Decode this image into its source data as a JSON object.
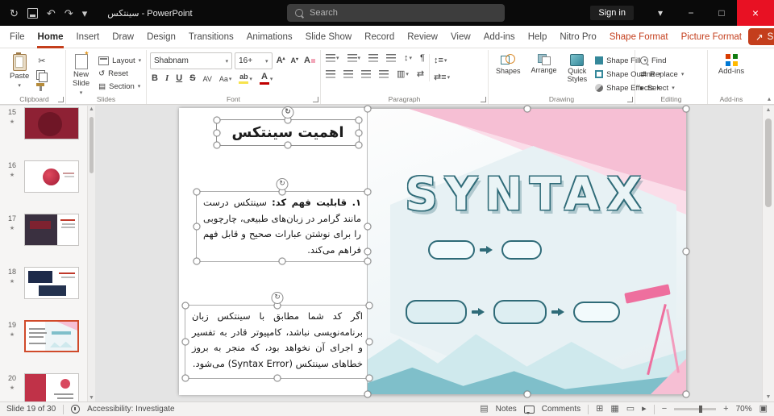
{
  "titlebar": {
    "title": "سینتکس - PowerPoint",
    "search_placeholder": "Search",
    "sign_in": "Sign in"
  },
  "menubar": {
    "tabs": [
      {
        "label": "File"
      },
      {
        "label": "Home"
      },
      {
        "label": "Insert"
      },
      {
        "label": "Draw"
      },
      {
        "label": "Design"
      },
      {
        "label": "Transitions"
      },
      {
        "label": "Animations"
      },
      {
        "label": "Slide Show"
      },
      {
        "label": "Record"
      },
      {
        "label": "Review"
      },
      {
        "label": "View"
      },
      {
        "label": "Add-ins"
      },
      {
        "label": "Help"
      },
      {
        "label": "Nitro Pro"
      },
      {
        "label": "Shape Format"
      },
      {
        "label": "Picture Format"
      }
    ],
    "active_tab": "Home",
    "share": "Share"
  },
  "ribbon": {
    "clipboard": {
      "paste": "Paste",
      "group": "Clipboard"
    },
    "slides": {
      "new_slide": "New Slide",
      "layout": "Layout",
      "reset": "Reset",
      "section": "Section",
      "group": "Slides"
    },
    "font": {
      "name": "Shabnam",
      "size": "16+",
      "group": "Font"
    },
    "paragraph": {
      "group": "Paragraph"
    },
    "drawing": {
      "shapes": "Shapes",
      "arrange": "Arrange",
      "quick_styles": "Quick Styles",
      "shape_fill": "Shape Fill",
      "shape_outline": "Shape Outline",
      "shape_effects": "Shape Effects",
      "group": "Drawing"
    },
    "editing": {
      "find": "Find",
      "replace": "Replace",
      "select": "Select",
      "group": "Editing"
    },
    "addins": {
      "button": "Add-ins",
      "group": "Add-ins"
    }
  },
  "panel": {
    "thumbs": [
      {
        "number": "15"
      },
      {
        "number": "16"
      },
      {
        "number": "17"
      },
      {
        "number": "18"
      },
      {
        "number": "19"
      },
      {
        "number": "20"
      }
    ],
    "selected": "19"
  },
  "slide": {
    "title": "اهمیت سینتکس",
    "body1_lead": "۱. قابلیت فهم کد:",
    "body1_rest": " سینتکس درست مانند گرامر در زبان‌های طبیعی، چارچوبی را برای نوشتن عبارات صحیح و قابل فهم فراهم می‌کند.",
    "body2": "اگر کد شما مطابق با سینتکس زبان برنامه‌نویسی نباشد، کامپیوتر قادر به تفسیر و اجرای آن نخواهد بود، که منجر به بروز خطاهای سینتکس (Syntax Error) می‌شود.",
    "graphic_word": "SYNTAX"
  },
  "statusbar": {
    "slide_info": "Slide 19 of 30",
    "accessibility": "Accessibility: Investigate",
    "notes": "Notes",
    "comments": "Comments",
    "zoom": "70%"
  },
  "colors": {
    "accent": "#c43e1c",
    "close_button": "#e81123",
    "thumbnail_selected_border": "#d04a2a",
    "illustration_pink": "#f6bfd4",
    "illustration_teal_outline": "#2f6b78",
    "illustration_light_teal": "#cfe9ed"
  }
}
